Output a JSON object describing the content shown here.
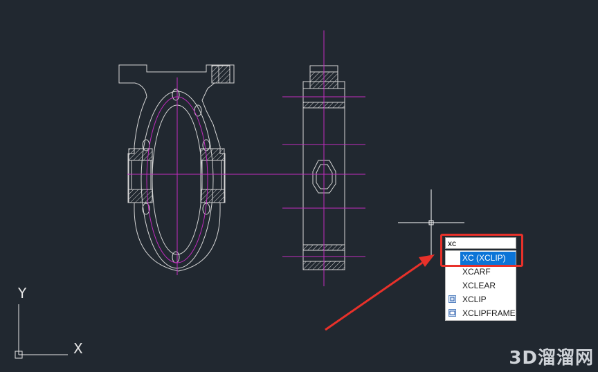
{
  "command_line": {
    "input_value": "xc"
  },
  "autocomplete": {
    "items": [
      {
        "label": "XC (XCLIP)",
        "selected": true,
        "icon": "none"
      },
      {
        "label": "XCARF",
        "selected": false,
        "icon": "none"
      },
      {
        "label": "XCLEAR",
        "selected": false,
        "icon": "none"
      },
      {
        "label": "XCLIP",
        "selected": false,
        "icon": "xclip-icon"
      },
      {
        "label": "XCLIPFRAME",
        "selected": false,
        "icon": "xclipframe-icon"
      }
    ]
  },
  "ucs": {
    "x_label": "X",
    "y_label": "Y"
  },
  "watermark": "3D溜溜网",
  "colors": {
    "background": "#212830",
    "geometry": "#d6d6d6",
    "centerline": "#c22bc0",
    "selection": "#0b74d7",
    "annotation": "#e8312a"
  }
}
